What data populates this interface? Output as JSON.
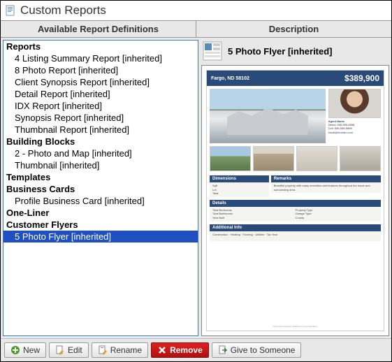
{
  "window": {
    "title": "Custom Reports"
  },
  "columns": {
    "left": "Available Report Definitions",
    "right": "Description"
  },
  "tree": [
    {
      "type": "cat",
      "label": "Reports"
    },
    {
      "type": "item",
      "label": "4 Listing Summary Report [inherited]"
    },
    {
      "type": "item",
      "label": "8 Photo Report [inherited]"
    },
    {
      "type": "item",
      "label": "Client Synopsis Report [inherited]"
    },
    {
      "type": "item",
      "label": "Detail Report [inherited]"
    },
    {
      "type": "item",
      "label": "IDX Report [inherited]"
    },
    {
      "type": "item",
      "label": "Synopsis Report [inherited]"
    },
    {
      "type": "item",
      "label": "Thumbnail Report [inherited]"
    },
    {
      "type": "cat",
      "label": "Building Blocks"
    },
    {
      "type": "item",
      "label": "2 - Photo and Map [inherited]"
    },
    {
      "type": "item",
      "label": "Thumbnail [inherited]"
    },
    {
      "type": "cat",
      "label": "Templates"
    },
    {
      "type": "cat",
      "label": "Business Cards"
    },
    {
      "type": "item",
      "label": "Profile Business Card [inherited]"
    },
    {
      "type": "cat",
      "label": "One-Liner"
    },
    {
      "type": "cat",
      "label": "Customer Flyers"
    },
    {
      "type": "item",
      "label": "5 Photo Flyer [inherited]",
      "selected": true
    }
  ],
  "description": {
    "title": "5 Photo Flyer [inherited]",
    "flyer": {
      "address": "Fargo, ND 58102",
      "price": "$389,900",
      "sections": {
        "dimensions": "Dimensions",
        "remarks": "Remarks",
        "details": "Details",
        "additional": "Additional Info"
      }
    }
  },
  "toolbar": {
    "new": "New",
    "edit": "Edit",
    "rename": "Rename",
    "remove": "Remove",
    "give": "Give to Someone"
  }
}
